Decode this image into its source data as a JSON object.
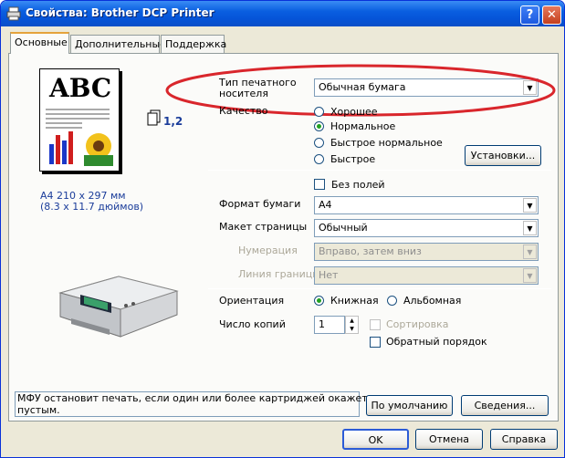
{
  "window": {
    "title": "Свойства: Brother DCP Printer"
  },
  "tabs": [
    {
      "label": "Основные"
    },
    {
      "label": "Дополнительные"
    },
    {
      "label": "Поддержка"
    }
  ],
  "preview": {
    "abc": "ABC",
    "copies_label": "1,2",
    "paper_size_line1": "A4 210 x 297 мм",
    "paper_size_line2": "(8.3 x 11.7 дюймов)"
  },
  "media": {
    "label_line1": "Тип печатного",
    "label_line2": "носителя",
    "value": "Обычная бумага"
  },
  "quality": {
    "label": "Качество",
    "options": [
      "Хорошее",
      "Нормальное",
      "Быстрое нормальное",
      "Быстрое"
    ],
    "selected": "Нормальное",
    "settings_button": "Установки..."
  },
  "borderless": {
    "label": "Без полей",
    "checked": false
  },
  "paper_format": {
    "label": "Формат бумаги",
    "value": "A4"
  },
  "page_layout": {
    "label": "Макет страницы",
    "value": "Обычный"
  },
  "page_order": {
    "label": "Нумерация",
    "value": "Вправо, затем вниз"
  },
  "border_line": {
    "label": "Линия границы",
    "value": "Нет"
  },
  "orientation": {
    "label": "Ориентация",
    "portrait": "Книжная",
    "landscape": "Альбомная",
    "selected": "Книжная"
  },
  "copies": {
    "label": "Число копий",
    "value": "1",
    "collate": "Сортировка",
    "reverse": "Обратный порядок",
    "collate_checked": false,
    "reverse_checked": false
  },
  "status": {
    "message_line1": "МФУ остановит печать, если один или более картриджей окажется",
    "message_line2": "пустым."
  },
  "buttons": {
    "default": "По умолчанию",
    "about": "Сведения...",
    "ok": "OK",
    "cancel": "Отмена",
    "help": "Справка"
  },
  "highlight_color": "#d9262c"
}
